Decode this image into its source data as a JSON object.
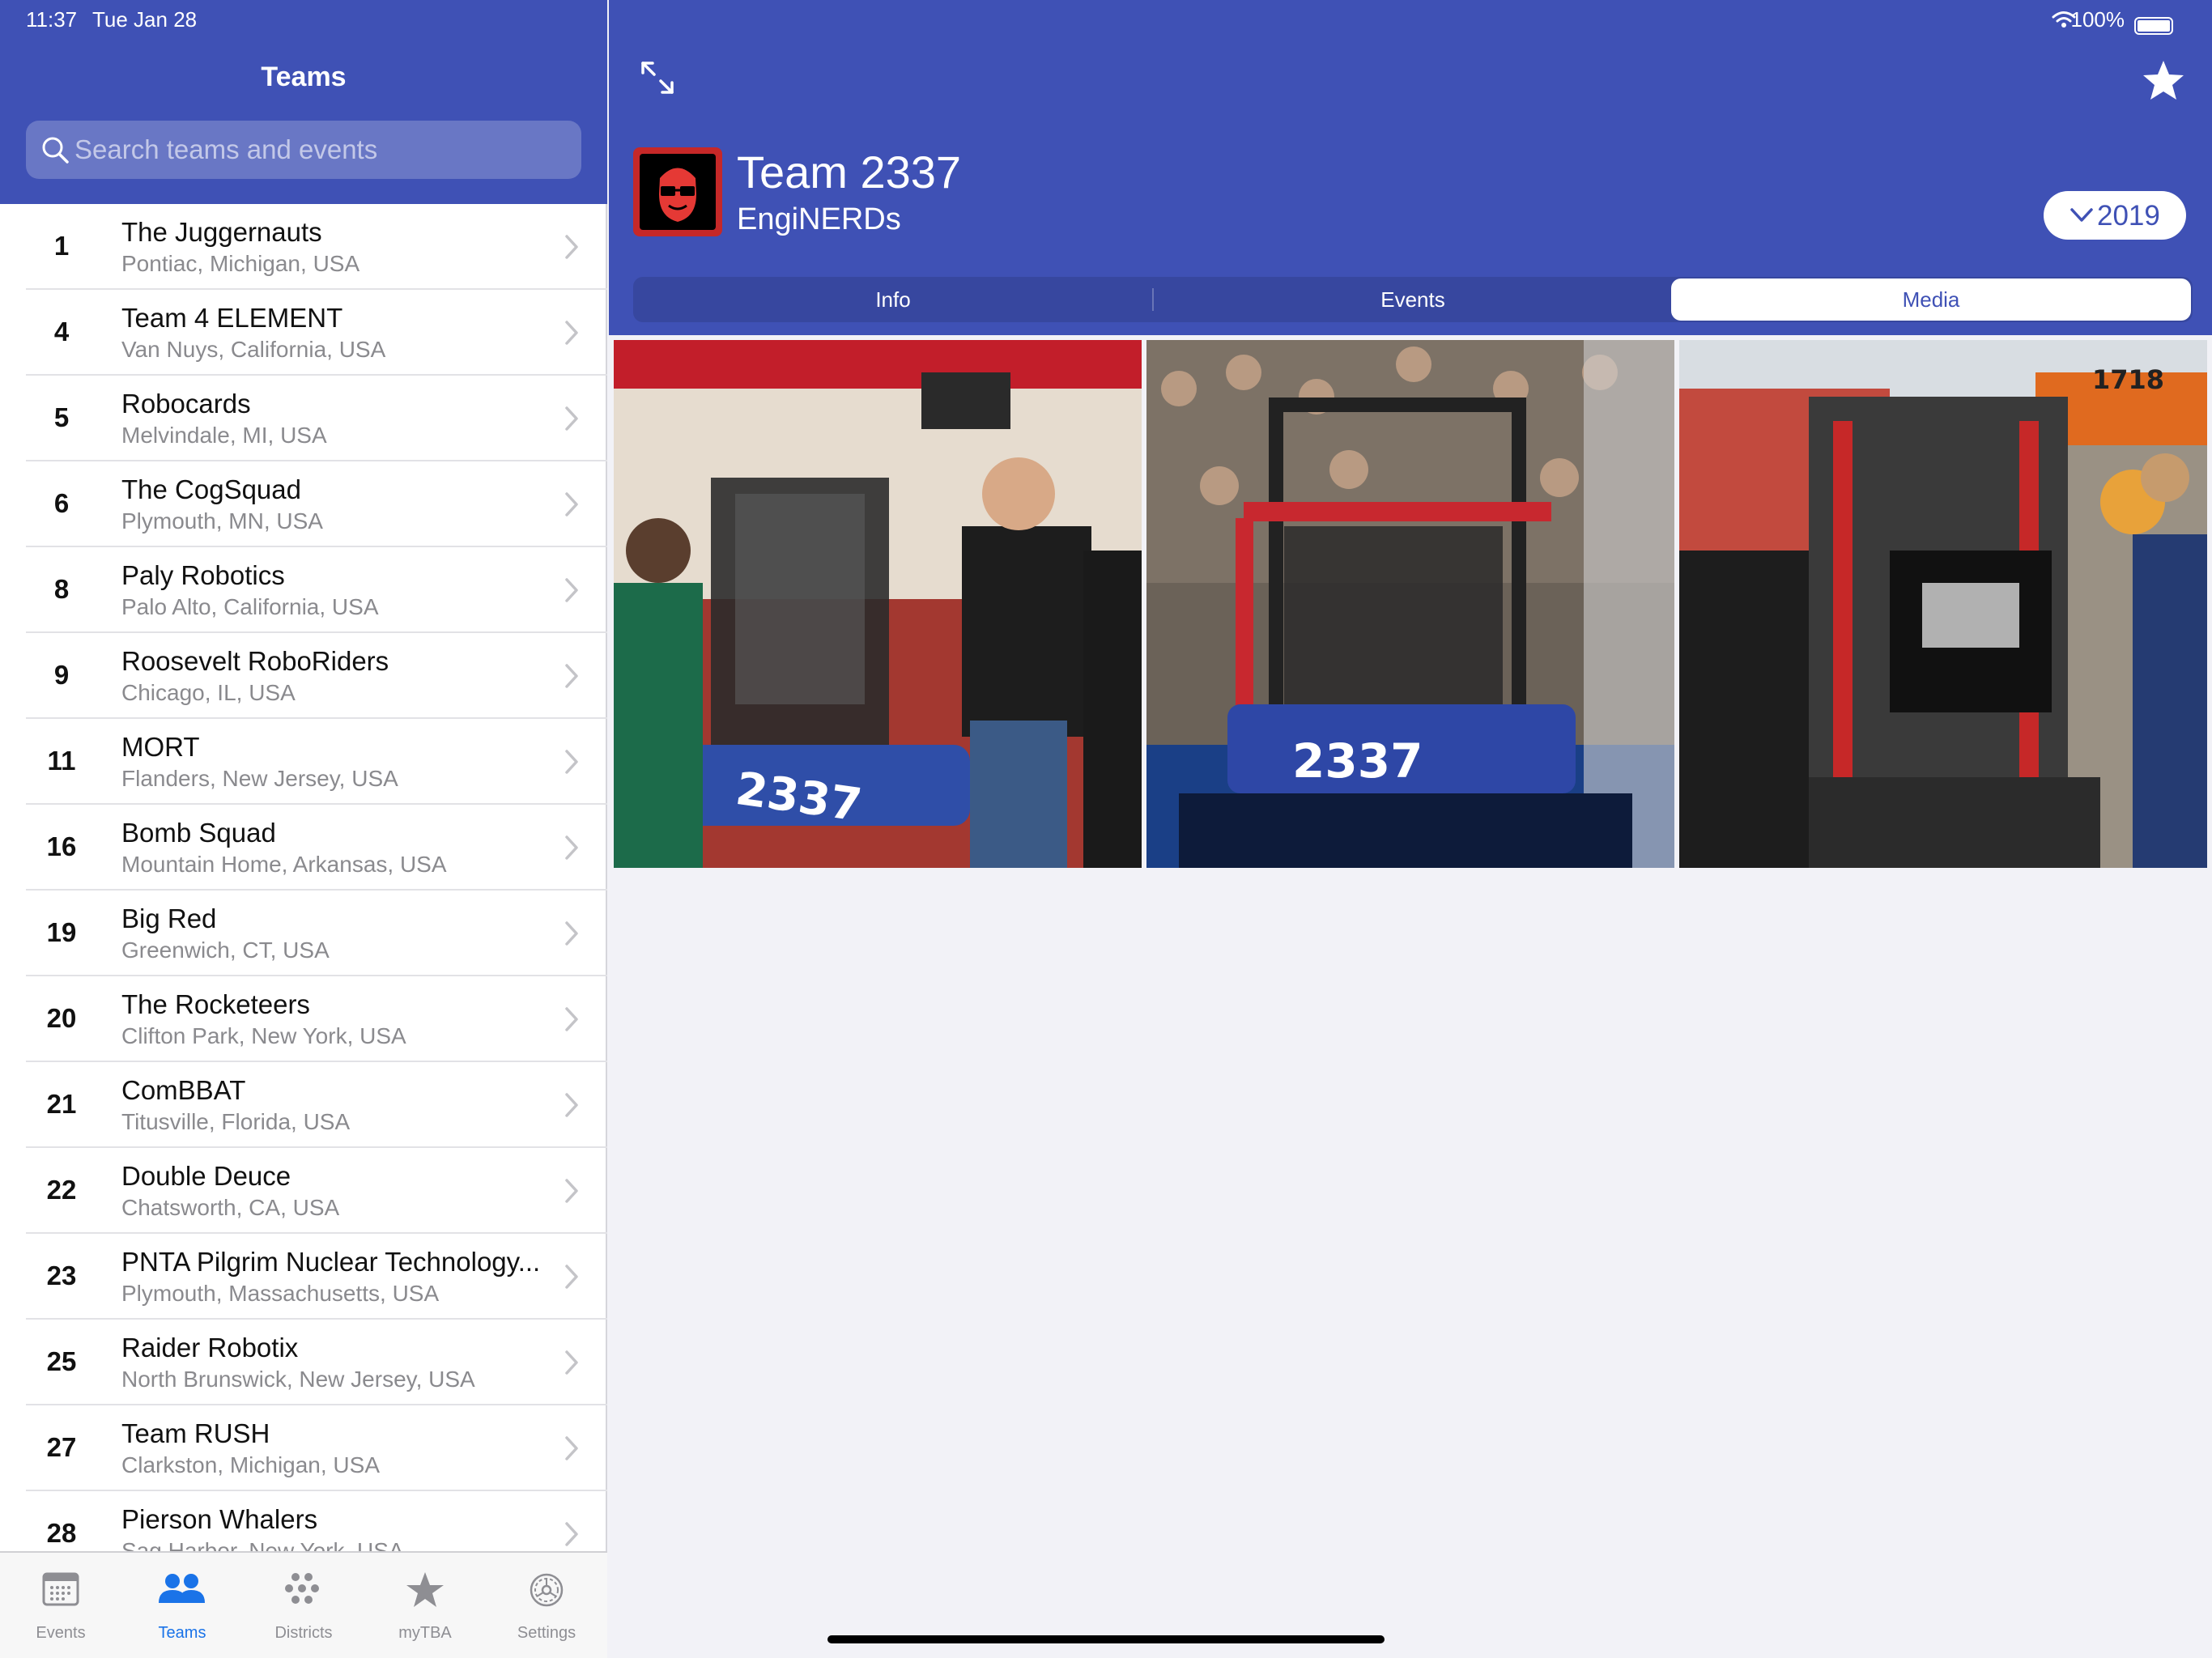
{
  "status_bar": {
    "time": "11:37",
    "date": "Tue Jan 28",
    "battery": "100%"
  },
  "left": {
    "title": "Teams",
    "search_placeholder": "Search teams and events",
    "teams": [
      {
        "number": "1",
        "name": "The Juggernauts",
        "location": "Pontiac, Michigan, USA"
      },
      {
        "number": "4",
        "name": "Team 4 ELEMENT",
        "location": "Van Nuys, California, USA"
      },
      {
        "number": "5",
        "name": "Robocards",
        "location": "Melvindale, MI, USA"
      },
      {
        "number": "6",
        "name": "The CogSquad",
        "location": "Plymouth, MN, USA"
      },
      {
        "number": "8",
        "name": "Paly Robotics",
        "location": "Palo Alto, California, USA"
      },
      {
        "number": "9",
        "name": "Roosevelt RoboRiders",
        "location": "Chicago, IL, USA"
      },
      {
        "number": "11",
        "name": "MORT",
        "location": "Flanders, New Jersey, USA"
      },
      {
        "number": "16",
        "name": "Bomb Squad",
        "location": "Mountain Home, Arkansas, USA"
      },
      {
        "number": "19",
        "name": "Big Red",
        "location": "Greenwich, CT, USA"
      },
      {
        "number": "20",
        "name": "The Rocketeers",
        "location": "Clifton Park, New York, USA"
      },
      {
        "number": "21",
        "name": "ComBBAT",
        "location": "Titusville, Florida, USA"
      },
      {
        "number": "22",
        "name": "Double Deuce",
        "location": "Chatsworth, CA, USA"
      },
      {
        "number": "23",
        "name": "PNTA Pilgrim Nuclear Technology...",
        "location": "Plymouth, Massachusetts, USA"
      },
      {
        "number": "25",
        "name": "Raider Robotix",
        "location": "North Brunswick, New Jersey, USA"
      },
      {
        "number": "27",
        "name": "Team RUSH",
        "location": "Clarkston, Michigan, USA"
      },
      {
        "number": "28",
        "name": "Pierson Whalers",
        "location": "Sag Harbor, New York, USA"
      }
    ]
  },
  "tabbar": {
    "tabs": [
      {
        "label": "Events",
        "icon": "calendar-icon"
      },
      {
        "label": "Teams",
        "icon": "people-icon"
      },
      {
        "label": "Districts",
        "icon": "districts-icon"
      },
      {
        "label": "myTBA",
        "icon": "star-icon"
      },
      {
        "label": "Settings",
        "icon": "gear-icon"
      }
    ],
    "active": "Teams"
  },
  "detail": {
    "team_title": "Team 2337",
    "team_nickname": "EngiNERDs",
    "year": "2019",
    "segments": [
      "Info",
      "Events",
      "Media"
    ],
    "active_segment": "Media",
    "photos": [
      {
        "robot_number": "2337"
      },
      {
        "robot_number": "2337"
      },
      {
        "sign_number": "1718"
      }
    ]
  },
  "colors": {
    "primary": "#3f51b5",
    "tab_active": "#1a73e8",
    "avatar_border": "#c62828"
  }
}
